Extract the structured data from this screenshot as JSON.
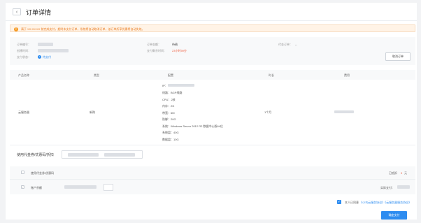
{
  "header": {
    "back_glyph": "‹",
    "title": "订单详情"
  },
  "notice": {
    "icon_glyph": "!",
    "text": "请于 XX:XX:XX 前完成支付，超时未支付订单，系统将自动取消订单，该订单所享优惠将自动失效。"
  },
  "order_info": {
    "order_no_label": "订单编号：",
    "create_time_label": "创建时间：",
    "pay_status_label": "支付状态：",
    "pay_status_value": "待支付",
    "pay_status_icon": "•",
    "order_amount_label": "订单金额：",
    "order_amount_value": "待确",
    "pay_countdown_label": "支付剩余时间：",
    "pay_countdown_value": "23小时59分",
    "voucher_label": "代金订单：",
    "voucher_value": "--",
    "cancel_label": "取消订单"
  },
  "table": {
    "columns": [
      "产品名称",
      "类型",
      "配置",
      "时长",
      "费用"
    ],
    "row": {
      "product": "云服务器",
      "type": "新购",
      "duration": "1个月",
      "specs": [
        "IP：",
        "线路：BGP线路",
        "CPU：2核",
        "内存：2G",
        "带宽：6M",
        "防御：20G",
        "系统：Windows Server 2012 R2 数据中心版64位",
        "系统盘：40G",
        "数据盘：10G"
      ]
    }
  },
  "coupon": {
    "label": "使用代金券/优惠码/折扣"
  },
  "payment": {
    "use_voucher_label": "使用代金券/优惠码",
    "discount_label": "已抵扣",
    "discount_value": "0",
    "discount_unit": "元",
    "balance_label": "账户余额",
    "balance_check_glyph": "✓",
    "actual_pay_label": "实际支付："
  },
  "agreement": {
    "check_glyph": "✓",
    "text": "本人已同意",
    "link": "《小鸟云服务协议》《云服务器服务协议》"
  },
  "confirm_label": "确定支付"
}
